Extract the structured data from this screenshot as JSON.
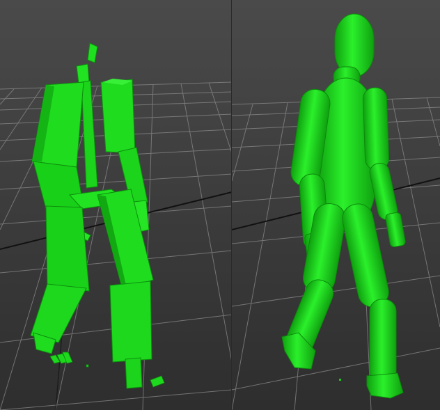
{
  "scene": {
    "background_top": "#454545",
    "background_bottom": "#2c2c2c",
    "grid_color": "#8c8c8c",
    "axis_color": "#111111",
    "mesh_color": "#1ee51e",
    "mesh_shade": "#12b012",
    "mesh_highlight": "#5cff5c"
  },
  "viewports": [
    {
      "id": "left",
      "content": "rigid-box-figure"
    },
    {
      "id": "right",
      "content": "smooth-capsule-figure"
    }
  ]
}
